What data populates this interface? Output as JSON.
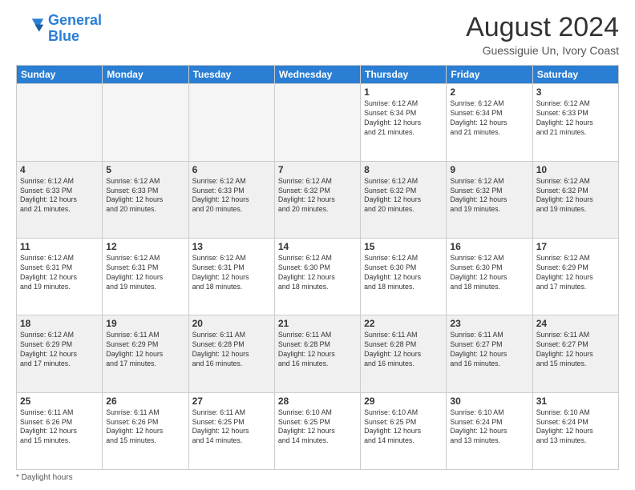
{
  "header": {
    "logo_line1": "General",
    "logo_line2": "Blue",
    "month_title": "August 2024",
    "location": "Guessiguie Un, Ivory Coast"
  },
  "footer": {
    "note": "Daylight hours"
  },
  "weekdays": [
    "Sunday",
    "Monday",
    "Tuesday",
    "Wednesday",
    "Thursday",
    "Friday",
    "Saturday"
  ],
  "weeks": [
    [
      {
        "day": "",
        "info": ""
      },
      {
        "day": "",
        "info": ""
      },
      {
        "day": "",
        "info": ""
      },
      {
        "day": "",
        "info": ""
      },
      {
        "day": "1",
        "info": "Sunrise: 6:12 AM\nSunset: 6:34 PM\nDaylight: 12 hours\nand 21 minutes."
      },
      {
        "day": "2",
        "info": "Sunrise: 6:12 AM\nSunset: 6:34 PM\nDaylight: 12 hours\nand 21 minutes."
      },
      {
        "day": "3",
        "info": "Sunrise: 6:12 AM\nSunset: 6:33 PM\nDaylight: 12 hours\nand 21 minutes."
      }
    ],
    [
      {
        "day": "4",
        "info": "Sunrise: 6:12 AM\nSunset: 6:33 PM\nDaylight: 12 hours\nand 21 minutes."
      },
      {
        "day": "5",
        "info": "Sunrise: 6:12 AM\nSunset: 6:33 PM\nDaylight: 12 hours\nand 20 minutes."
      },
      {
        "day": "6",
        "info": "Sunrise: 6:12 AM\nSunset: 6:33 PM\nDaylight: 12 hours\nand 20 minutes."
      },
      {
        "day": "7",
        "info": "Sunrise: 6:12 AM\nSunset: 6:32 PM\nDaylight: 12 hours\nand 20 minutes."
      },
      {
        "day": "8",
        "info": "Sunrise: 6:12 AM\nSunset: 6:32 PM\nDaylight: 12 hours\nand 20 minutes."
      },
      {
        "day": "9",
        "info": "Sunrise: 6:12 AM\nSunset: 6:32 PM\nDaylight: 12 hours\nand 19 minutes."
      },
      {
        "day": "10",
        "info": "Sunrise: 6:12 AM\nSunset: 6:32 PM\nDaylight: 12 hours\nand 19 minutes."
      }
    ],
    [
      {
        "day": "11",
        "info": "Sunrise: 6:12 AM\nSunset: 6:31 PM\nDaylight: 12 hours\nand 19 minutes."
      },
      {
        "day": "12",
        "info": "Sunrise: 6:12 AM\nSunset: 6:31 PM\nDaylight: 12 hours\nand 19 minutes."
      },
      {
        "day": "13",
        "info": "Sunrise: 6:12 AM\nSunset: 6:31 PM\nDaylight: 12 hours\nand 18 minutes."
      },
      {
        "day": "14",
        "info": "Sunrise: 6:12 AM\nSunset: 6:30 PM\nDaylight: 12 hours\nand 18 minutes."
      },
      {
        "day": "15",
        "info": "Sunrise: 6:12 AM\nSunset: 6:30 PM\nDaylight: 12 hours\nand 18 minutes."
      },
      {
        "day": "16",
        "info": "Sunrise: 6:12 AM\nSunset: 6:30 PM\nDaylight: 12 hours\nand 18 minutes."
      },
      {
        "day": "17",
        "info": "Sunrise: 6:12 AM\nSunset: 6:29 PM\nDaylight: 12 hours\nand 17 minutes."
      }
    ],
    [
      {
        "day": "18",
        "info": "Sunrise: 6:12 AM\nSunset: 6:29 PM\nDaylight: 12 hours\nand 17 minutes."
      },
      {
        "day": "19",
        "info": "Sunrise: 6:11 AM\nSunset: 6:29 PM\nDaylight: 12 hours\nand 17 minutes."
      },
      {
        "day": "20",
        "info": "Sunrise: 6:11 AM\nSunset: 6:28 PM\nDaylight: 12 hours\nand 16 minutes."
      },
      {
        "day": "21",
        "info": "Sunrise: 6:11 AM\nSunset: 6:28 PM\nDaylight: 12 hours\nand 16 minutes."
      },
      {
        "day": "22",
        "info": "Sunrise: 6:11 AM\nSunset: 6:28 PM\nDaylight: 12 hours\nand 16 minutes."
      },
      {
        "day": "23",
        "info": "Sunrise: 6:11 AM\nSunset: 6:27 PM\nDaylight: 12 hours\nand 16 minutes."
      },
      {
        "day": "24",
        "info": "Sunrise: 6:11 AM\nSunset: 6:27 PM\nDaylight: 12 hours\nand 15 minutes."
      }
    ],
    [
      {
        "day": "25",
        "info": "Sunrise: 6:11 AM\nSunset: 6:26 PM\nDaylight: 12 hours\nand 15 minutes."
      },
      {
        "day": "26",
        "info": "Sunrise: 6:11 AM\nSunset: 6:26 PM\nDaylight: 12 hours\nand 15 minutes."
      },
      {
        "day": "27",
        "info": "Sunrise: 6:11 AM\nSunset: 6:25 PM\nDaylight: 12 hours\nand 14 minutes."
      },
      {
        "day": "28",
        "info": "Sunrise: 6:10 AM\nSunset: 6:25 PM\nDaylight: 12 hours\nand 14 minutes."
      },
      {
        "day": "29",
        "info": "Sunrise: 6:10 AM\nSunset: 6:25 PM\nDaylight: 12 hours\nand 14 minutes."
      },
      {
        "day": "30",
        "info": "Sunrise: 6:10 AM\nSunset: 6:24 PM\nDaylight: 12 hours\nand 13 minutes."
      },
      {
        "day": "31",
        "info": "Sunrise: 6:10 AM\nSunset: 6:24 PM\nDaylight: 12 hours\nand 13 minutes."
      }
    ]
  ]
}
